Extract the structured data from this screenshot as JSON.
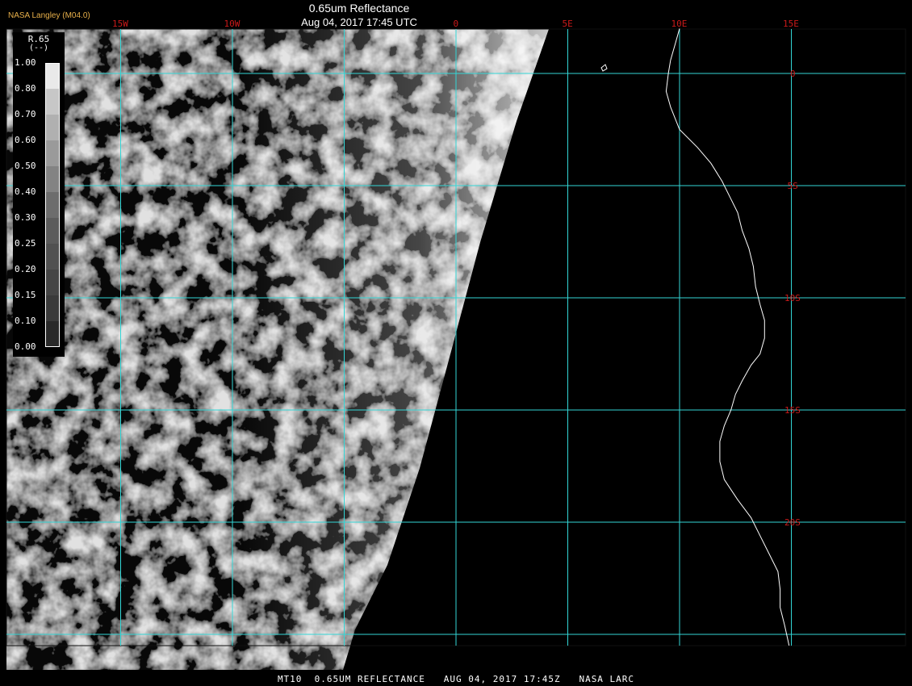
{
  "producer": "NASA Langley (M04.0)",
  "title": "0.65um Reflectance",
  "subtitle": "Aug 04, 2017 17:45 UTC",
  "footer": "MT10  0.65UM REFLECTANCE   AUG 04, 2017 17:45Z   NASA LARC",
  "legend": {
    "variable": "R.65",
    "unit": "(--)",
    "labels": [
      "1.00",
      "0.80",
      "0.70",
      "0.60",
      "0.50",
      "0.40",
      "0.30",
      "0.25",
      "0.20",
      "0.15",
      "0.10",
      "0.00"
    ],
    "levels": [
      1.0,
      0.8,
      0.7,
      0.6,
      0.5,
      0.4,
      0.3,
      0.25,
      0.2,
      0.15,
      0.1,
      0.0
    ]
  },
  "grid": {
    "color": "#33d6d6",
    "label_color": "#cc1a1a",
    "longitudes": [
      {
        "value": -15,
        "label": "15W"
      },
      {
        "value": -10,
        "label": "10W"
      },
      {
        "value": -5,
        "label": ""
      },
      {
        "value": 0,
        "label": "0"
      },
      {
        "value": 5,
        "label": "5E"
      },
      {
        "value": 10,
        "label": "10E"
      },
      {
        "value": 15,
        "label": "15E"
      }
    ],
    "latitudes": [
      {
        "value": 0,
        "label": "0"
      },
      {
        "value": -5,
        "label": "5S"
      },
      {
        "value": -10,
        "label": "10S"
      },
      {
        "value": -15,
        "label": "15S"
      },
      {
        "value": -20,
        "label": "20S"
      },
      {
        "value": -25,
        "label": ""
      }
    ]
  },
  "coastline": [
    [
      10.0,
      2.0
    ],
    [
      9.8,
      1.3
    ],
    [
      9.6,
      0.6
    ],
    [
      9.5,
      0.0
    ],
    [
      9.4,
      -0.8
    ],
    [
      9.6,
      -1.5
    ],
    [
      10.0,
      -2.5
    ],
    [
      10.8,
      -3.3
    ],
    [
      11.4,
      -4.0
    ],
    [
      11.9,
      -4.8
    ],
    [
      12.3,
      -5.6
    ],
    [
      12.6,
      -6.2
    ],
    [
      12.8,
      -7.0
    ],
    [
      13.1,
      -7.8
    ],
    [
      13.3,
      -8.6
    ],
    [
      13.4,
      -9.5
    ],
    [
      13.6,
      -10.3
    ],
    [
      13.8,
      -11.0
    ],
    [
      13.8,
      -11.8
    ],
    [
      13.6,
      -12.5
    ],
    [
      13.2,
      -13.0
    ],
    [
      12.8,
      -13.7
    ],
    [
      12.5,
      -14.3
    ],
    [
      12.3,
      -15.0
    ],
    [
      12.0,
      -15.7
    ],
    [
      11.8,
      -16.4
    ],
    [
      11.8,
      -17.3
    ],
    [
      12.0,
      -18.1
    ],
    [
      12.6,
      -19.0
    ],
    [
      13.2,
      -19.8
    ],
    [
      13.6,
      -20.6
    ],
    [
      14.0,
      -21.4
    ],
    [
      14.4,
      -22.2
    ],
    [
      14.5,
      -23.0
    ],
    [
      14.5,
      -23.8
    ],
    [
      14.7,
      -24.6
    ],
    [
      14.9,
      -25.5
    ]
  ]
}
